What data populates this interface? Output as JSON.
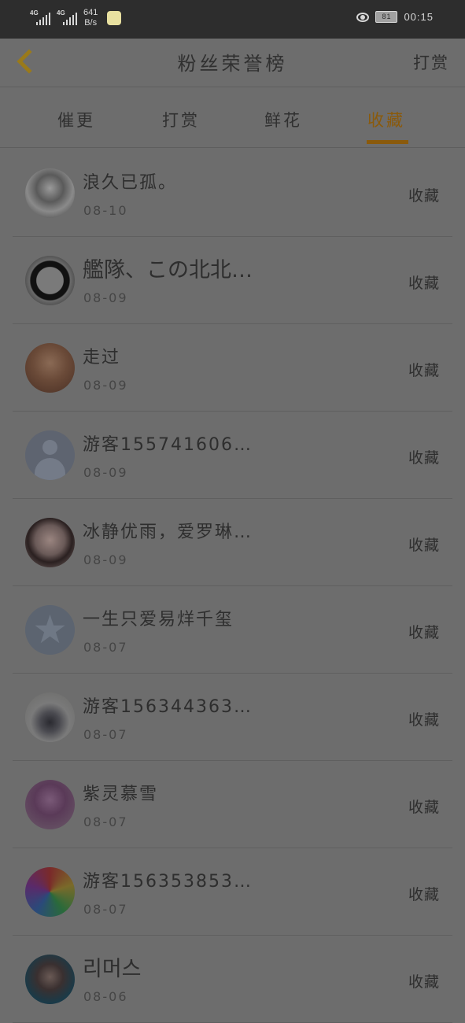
{
  "status_bar": {
    "signal1_label": "4G",
    "signal2_label": "4G",
    "speed_value": "641",
    "speed_unit": "B/s",
    "battery": "81",
    "time": "00:15"
  },
  "header": {
    "title": "粉丝荣誉榜",
    "right_action": "打赏"
  },
  "tabs": [
    {
      "label": "催更",
      "active": false
    },
    {
      "label": "打赏",
      "active": false
    },
    {
      "label": "鲜花",
      "active": false
    },
    {
      "label": "收藏",
      "active": true
    }
  ],
  "accent_color": "#8a5a0c",
  "list": [
    {
      "name": "浪久已孤。",
      "date": "08-10",
      "action": "收藏",
      "avatar": "avatar-girl-sketch"
    },
    {
      "name": "艦隊、この北北…",
      "date": "08-09",
      "action": "收藏",
      "avatar": "avatar-anime-circle"
    },
    {
      "name": "走过",
      "date": "08-09",
      "action": "收藏",
      "avatar": "avatar-sunset-couple"
    },
    {
      "name": "游客155741606…",
      "date": "08-09",
      "action": "收藏",
      "avatar": "avatar-default-person"
    },
    {
      "name": "冰静优雨，爱罗琳…",
      "date": "08-09",
      "action": "收藏",
      "avatar": "avatar-anime-girl"
    },
    {
      "name": "一生只爱易烊千玺",
      "date": "08-07",
      "action": "收藏",
      "avatar": "avatar-qzone-star"
    },
    {
      "name": "游客156344363…",
      "date": "08-07",
      "action": "收藏",
      "avatar": "avatar-wedding-couple"
    },
    {
      "name": "紫灵慕雪",
      "date": "08-07",
      "action": "收藏",
      "avatar": "avatar-flower-girl"
    },
    {
      "name": "游客156353853…",
      "date": "08-07",
      "action": "收藏",
      "avatar": "avatar-rainbow-rose"
    },
    {
      "name": "리머스",
      "date": "08-06",
      "action": "收藏",
      "avatar": "avatar-dark-portrait"
    }
  ]
}
